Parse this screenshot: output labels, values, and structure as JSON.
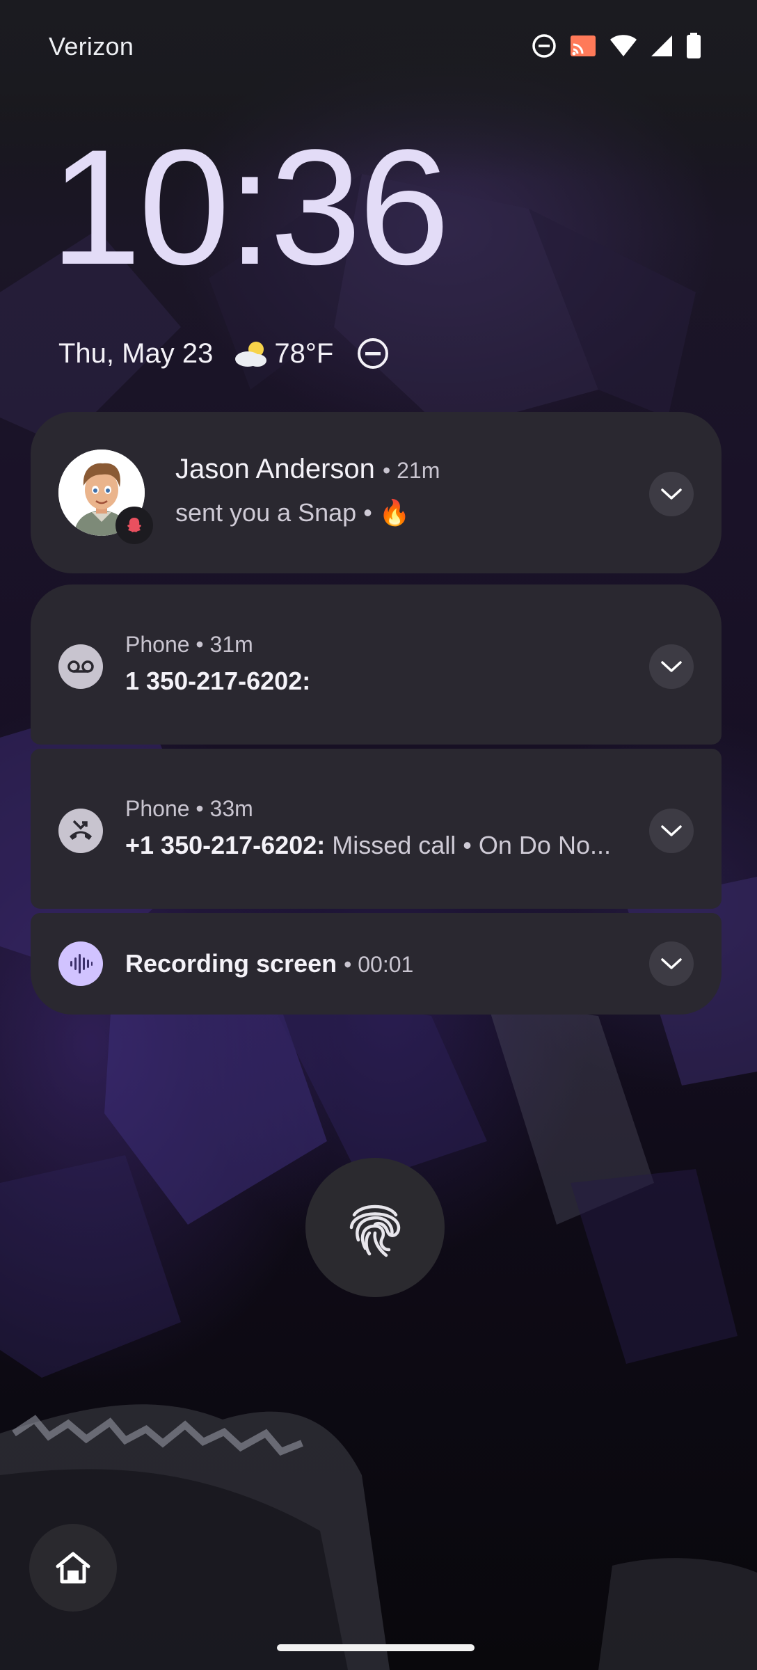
{
  "status_bar": {
    "carrier": "Verizon",
    "icons": [
      "do-not-disturb-icon",
      "cast-icon",
      "wifi-icon",
      "cell-signal-icon",
      "battery-icon"
    ]
  },
  "lockscreen": {
    "time": "10:36",
    "date": "Thu, May 23",
    "temperature": "78°F",
    "weather_icon": "partly-cloudy-icon",
    "dnd_icon": "do-not-disturb-icon"
  },
  "notifications": [
    {
      "app": "Snapchat",
      "sender": "Jason Anderson",
      "time": "• 21m",
      "text": "sent you a Snap • 🔥"
    },
    {
      "app_line": "Phone • 31m",
      "title": "1 350-217-6202:",
      "text": ""
    },
    {
      "app_line": "Phone • 33m",
      "title": "+1 350-217-6202:",
      "text": "Missed call • On Do No..."
    },
    {
      "title": "Recording screen",
      "time": "• 00:01"
    }
  ],
  "colors": {
    "clock": "#e3dcf7",
    "card_bg": "#2a2830",
    "recording_accent": "#d1c3ff"
  }
}
